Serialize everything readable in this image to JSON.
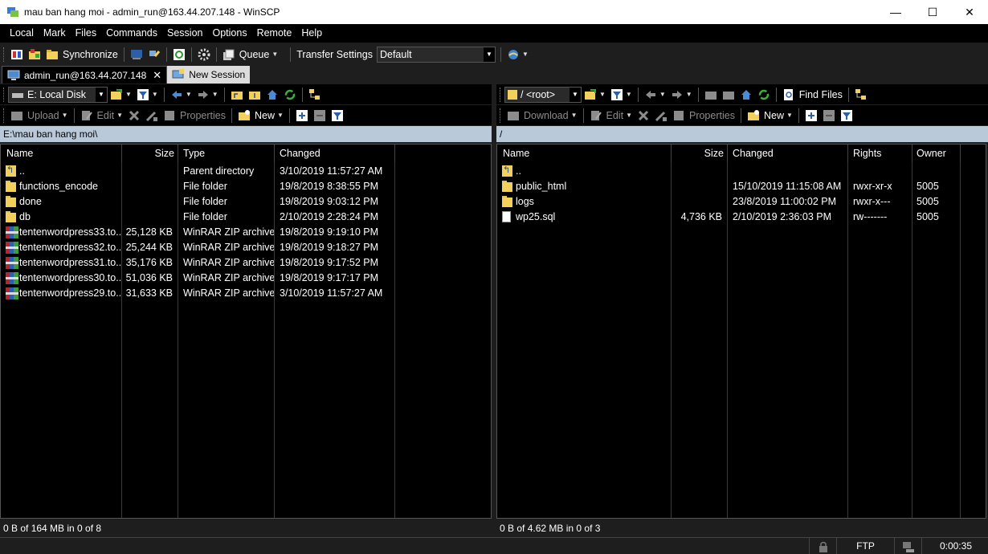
{
  "window": {
    "title": "mau ban hang moi - admin_run@163.44.207.148 - WinSCP",
    "minimize": "—",
    "maximize": "☐",
    "close": "✕"
  },
  "menu": [
    "Local",
    "Mark",
    "Files",
    "Commands",
    "Session",
    "Options",
    "Remote",
    "Help"
  ],
  "main_toolbar": {
    "synchronize": "Synchronize",
    "queue": "Queue",
    "transfer_settings_label": "Transfer Settings",
    "transfer_settings_value": "Default"
  },
  "tabs": [
    {
      "label": "admin_run@163.44.207.148",
      "close": "✕",
      "active": true
    },
    {
      "label": "New Session",
      "active": false
    }
  ],
  "left": {
    "drive": "E: Local Disk",
    "actions": {
      "upload": "Upload",
      "edit": "Edit",
      "properties": "Properties",
      "new": "New"
    },
    "path": "E:\\mau ban hang moi\\",
    "columns": [
      "Name",
      "Size",
      "Type",
      "Changed"
    ],
    "rows": [
      {
        "icon": "updir",
        "name": "..",
        "size": "",
        "type": "Parent directory",
        "changed": "3/10/2019  11:57:27 AM"
      },
      {
        "icon": "folder",
        "name": "functions_encode",
        "size": "",
        "type": "File folder",
        "changed": "19/8/2019  8:38:55 PM"
      },
      {
        "icon": "folder",
        "name": "done",
        "size": "",
        "type": "File folder",
        "changed": "19/8/2019  9:03:12 PM"
      },
      {
        "icon": "folder",
        "name": "db",
        "size": "",
        "type": "File folder",
        "changed": "2/10/2019  2:28:24 PM"
      },
      {
        "icon": "zip",
        "name": "tentenwordpress33.to...",
        "size": "25,128 KB",
        "type": "WinRAR ZIP archive",
        "changed": "19/8/2019  9:19:10 PM"
      },
      {
        "icon": "zip",
        "name": "tentenwordpress32.to...",
        "size": "25,244 KB",
        "type": "WinRAR ZIP archive",
        "changed": "19/8/2019  9:18:27 PM"
      },
      {
        "icon": "zip",
        "name": "tentenwordpress31.to...",
        "size": "35,176 KB",
        "type": "WinRAR ZIP archive",
        "changed": "19/8/2019  9:17:52 PM"
      },
      {
        "icon": "zip",
        "name": "tentenwordpress30.to...",
        "size": "51,036 KB",
        "type": "WinRAR ZIP archive",
        "changed": "19/8/2019  9:17:17 PM"
      },
      {
        "icon": "zip",
        "name": "tentenwordpress29.to...",
        "size": "31,633 KB",
        "type": "WinRAR ZIP archive",
        "changed": "3/10/2019  11:57:27 AM"
      }
    ],
    "status": "0 B of 164 MB in 0 of 8"
  },
  "right": {
    "drive": "/ <root>",
    "find_files": "Find Files",
    "actions": {
      "download": "Download",
      "edit": "Edit",
      "properties": "Properties",
      "new": "New"
    },
    "path": "/",
    "columns": [
      "Name",
      "Size",
      "Changed",
      "Rights",
      "Owner"
    ],
    "rows": [
      {
        "icon": "updir",
        "name": "..",
        "size": "",
        "changed": "",
        "rights": "",
        "owner": ""
      },
      {
        "icon": "folder",
        "name": "public_html",
        "size": "",
        "changed": "15/10/2019 11:15:08 AM",
        "rights": "rwxr-xr-x",
        "owner": "5005"
      },
      {
        "icon": "folder",
        "name": "logs",
        "size": "",
        "changed": "23/8/2019 11:00:02 PM",
        "rights": "rwxr-x---",
        "owner": "5005"
      },
      {
        "icon": "file",
        "name": "wp25.sql",
        "size": "4,736 KB",
        "changed": "2/10/2019 2:36:03 PM",
        "rights": "rw-------",
        "owner": "5005"
      }
    ],
    "status": "0 B of 4.62 MB in 0 of 3"
  },
  "bottom": {
    "protocol": "FTP",
    "timer": "0:00:35"
  },
  "colors": {
    "background": "#1e1e1e",
    "panel": "#000000",
    "pathbar": "#b9c9d9",
    "folder": "#f3cf5b"
  }
}
